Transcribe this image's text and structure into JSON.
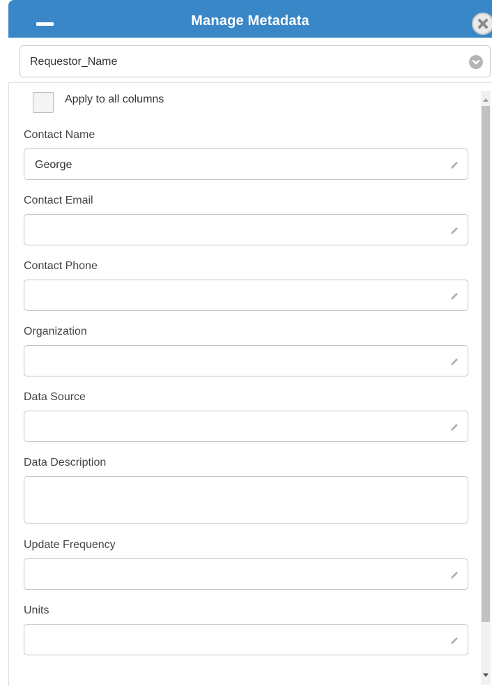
{
  "window": {
    "title": "Manage Metadata",
    "icons": {
      "minimize": "minimize-icon",
      "close": "close-circle-icon"
    }
  },
  "column_select": {
    "value": "Requestor_Name",
    "icon": "chevron-down-icon"
  },
  "apply_all": {
    "label": "Apply to all columns",
    "checked": false
  },
  "fields": [
    {
      "label": "Contact Name",
      "value": "George",
      "icon": "pencil-icon"
    },
    {
      "label": "Contact Email",
      "value": "",
      "icon": "pencil-icon"
    },
    {
      "label": "Contact Phone",
      "value": "",
      "icon": "pencil-icon"
    },
    {
      "label": "Organization",
      "value": "",
      "icon": "pencil-icon"
    },
    {
      "label": "Data Source",
      "value": "",
      "icon": "pencil-icon"
    },
    {
      "label": "Data Description",
      "value": "",
      "multiline": true
    },
    {
      "label": "Update Frequency",
      "value": "",
      "icon": "pencil-icon"
    },
    {
      "label": "Units",
      "value": "",
      "icon": "pencil-icon"
    }
  ],
  "colors": {
    "header": "#3a87c8",
    "border": "#c4c4c4",
    "scrollbar": "#c1c1c1"
  }
}
